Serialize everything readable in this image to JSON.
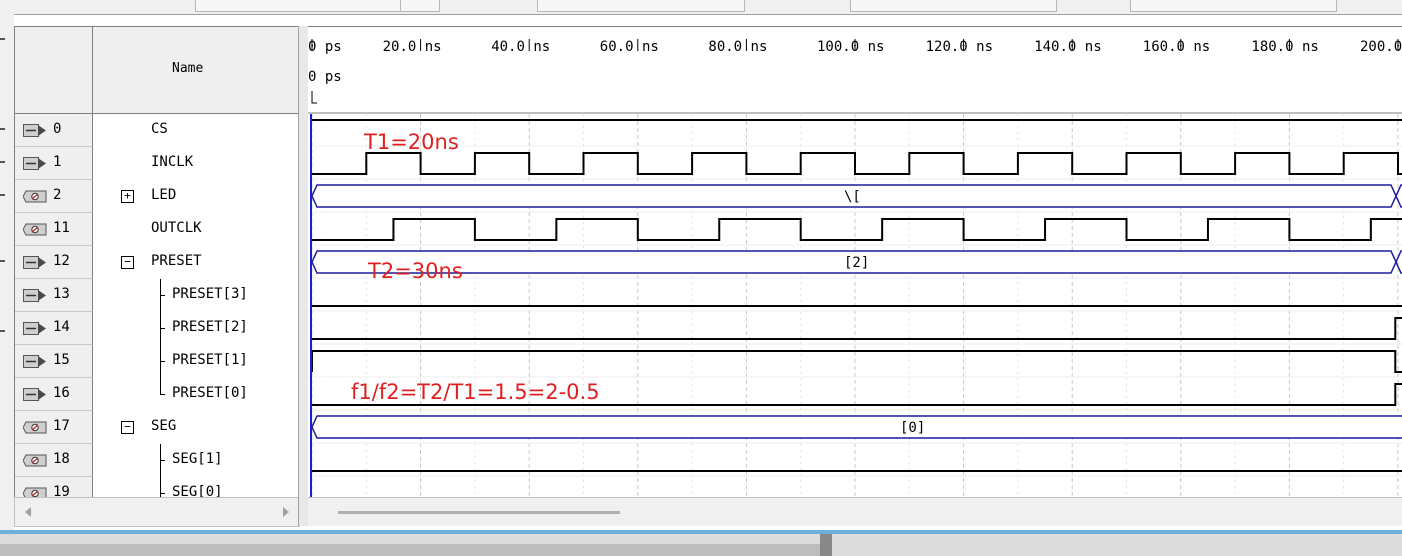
{
  "name_column": {
    "header": "Name"
  },
  "signals": [
    {
      "id": "0",
      "name": "CS",
      "pin": "input",
      "kind": "bit"
    },
    {
      "id": "1",
      "name": "INCLK",
      "pin": "input",
      "kind": "bit"
    },
    {
      "id": "2",
      "name": "LED",
      "pin": "output",
      "kind": "bus",
      "expander": "+"
    },
    {
      "id": "11",
      "name": "OUTCLK",
      "pin": "output",
      "kind": "bit"
    },
    {
      "id": "12",
      "name": "PRESET",
      "pin": "input",
      "kind": "bus",
      "expander": "−"
    },
    {
      "id": "13",
      "name": "PRESET[3]",
      "pin": "input",
      "kind": "child"
    },
    {
      "id": "14",
      "name": "PRESET[2]",
      "pin": "input",
      "kind": "child"
    },
    {
      "id": "15",
      "name": "PRESET[1]",
      "pin": "input",
      "kind": "child"
    },
    {
      "id": "16",
      "name": "PRESET[0]",
      "pin": "input",
      "kind": "child"
    },
    {
      "id": "17",
      "name": "SEG",
      "pin": "output",
      "kind": "bus",
      "expander": "−"
    },
    {
      "id": "18",
      "name": "SEG[1]",
      "pin": "output",
      "kind": "child"
    },
    {
      "id": "19",
      "name": "SEG[0]",
      "pin": "output",
      "kind": "child"
    }
  ],
  "timeline": {
    "ticks": [
      "0 ps",
      "20.0 ns",
      "40.0 ns",
      "60.0 ns",
      "80.0 ns",
      "100.0 ns",
      "120.0 ns",
      "140.0 ns",
      "160.0 ns",
      "180.0 ns",
      "200.0"
    ],
    "cursor_label": "0 ps"
  },
  "bus_values": {
    "LED": "\\[",
    "PRESET": "[2]",
    "SEG": "[0]"
  },
  "annotations": {
    "t1": "T1=20ns",
    "t2": "T2=30ns",
    "ratio": "f1/f2=T2/T1=1.5=2-0.5"
  },
  "colors": {
    "wave": "#000000",
    "bus": "#1c1c9c",
    "cursor": "#1c1cd0",
    "grid": "#c8c8c8",
    "annotation": "#e02020"
  },
  "icons": {
    "input_pin": "input-pin-icon",
    "output_pin": "output-pin-icon",
    "expand": "plus-box-icon",
    "collapse": "minus-box-icon",
    "scroll_left": "arrow-left-icon",
    "scroll_right": "arrow-right-icon"
  }
}
